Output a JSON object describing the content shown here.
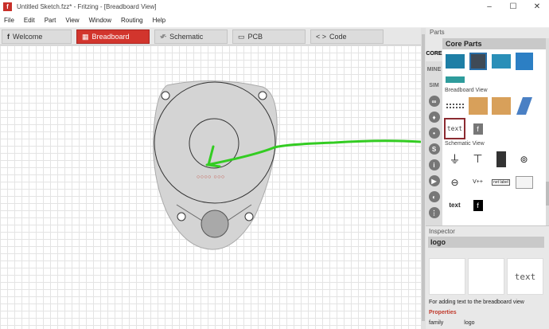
{
  "window": {
    "title": "Untitled Sketch.fzz* - Fritzing - [Breadboard View]",
    "controls": [
      "–",
      "☐",
      "✕"
    ]
  },
  "menu": [
    "File",
    "Edit",
    "Part",
    "View",
    "Window",
    "Routing",
    "Help"
  ],
  "tabs": [
    {
      "label": "Welcome",
      "icon": "f"
    },
    {
      "label": "Breadboard",
      "icon": "▦"
    },
    {
      "label": "Schematic",
      "icon": "-⁄⁄⁄-"
    },
    {
      "label": "PCB",
      "icon": "▭"
    },
    {
      "label": "Code",
      "icon": "< >"
    }
  ],
  "parts": {
    "panel_title": "Parts",
    "bin_title": "Core Parts",
    "bins": [
      "CORE",
      "MINE",
      "SIM"
    ],
    "section_breadboard": "Breadboard View",
    "section_schematic": "Schematic View",
    "text_item": "text",
    "net_label": "net label",
    "vcc_label": "V++"
  },
  "canvas": {
    "led_dots": "○○○○ ○○○"
  },
  "inspector": {
    "title": "Inspector",
    "part_name": "logo",
    "preview_text": "text",
    "description": "For adding text to the breadboard view",
    "properties_label": "Properties",
    "prop_key": "family",
    "prop_value": "logo"
  },
  "colors": {
    "accent": "#d2352d",
    "wire": "#33cc22"
  }
}
